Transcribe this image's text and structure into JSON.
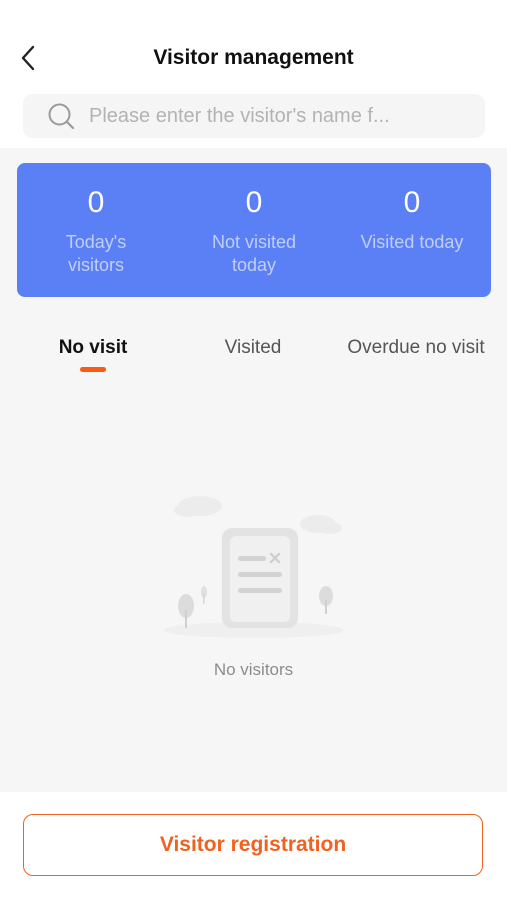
{
  "header": {
    "title": "Visitor management",
    "back_icon": "chevron-left-icon"
  },
  "search": {
    "placeholder": "Please enter the visitor's name f...",
    "value": "",
    "icon": "search-icon"
  },
  "stats": [
    {
      "value": "0",
      "label": "Today's\nvisitors"
    },
    {
      "value": "0",
      "label": "Not visited\ntoday"
    },
    {
      "value": "0",
      "label": "Visited today"
    }
  ],
  "tabs": [
    {
      "label": "No visit",
      "active": true
    },
    {
      "label": "Visited",
      "active": false
    },
    {
      "label": "Overdue no visit",
      "active": false
    }
  ],
  "empty_state": {
    "icon": "empty-document-icon",
    "text": "No visitors"
  },
  "footer": {
    "register_label": "Visitor registration"
  },
  "colors": {
    "accent": "#f0621f",
    "stats_background": "#5b7ff5",
    "tab_indicator": "#fa5a14"
  }
}
